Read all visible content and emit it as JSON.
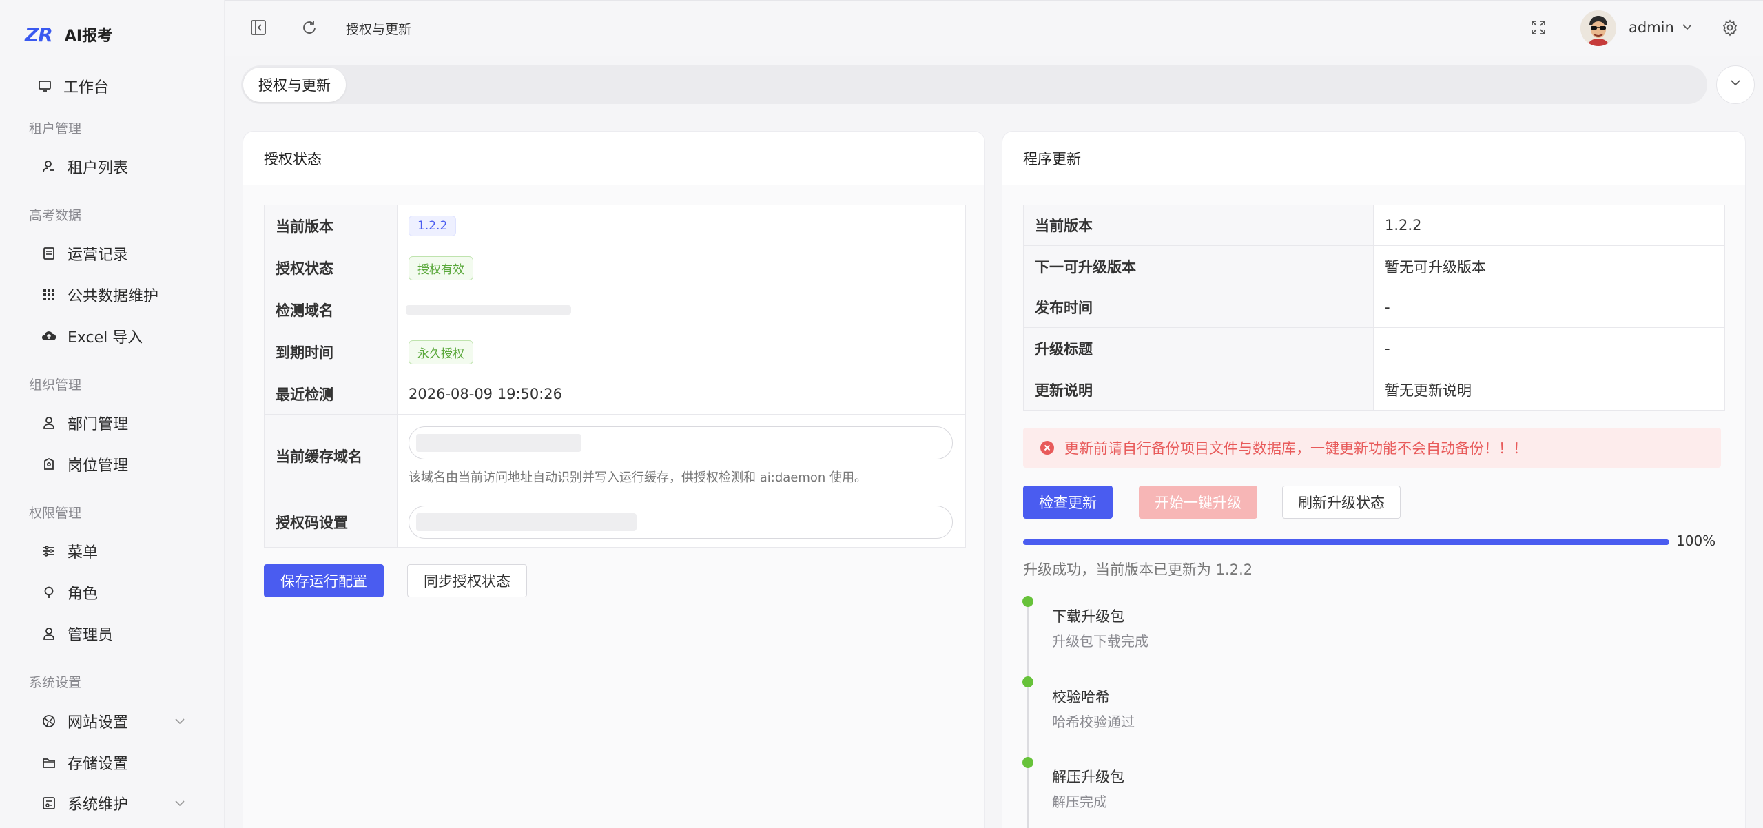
{
  "brand": {
    "logo_mark": "ZR",
    "app_name": "AI报考"
  },
  "sidebar": {
    "workbench": "工作台",
    "groups": [
      {
        "title": "租户管理",
        "items": [
          {
            "label": "租户列表",
            "icon": "user-list-icon"
          }
        ]
      },
      {
        "title": "高考数据",
        "items": [
          {
            "label": "运营记录",
            "icon": "document-icon"
          },
          {
            "label": "公共数据维护",
            "icon": "grid-icon"
          },
          {
            "label": "Excel 导入",
            "icon": "cloud-upload-icon"
          }
        ]
      },
      {
        "title": "组织管理",
        "items": [
          {
            "label": "部门管理",
            "icon": "user-icon"
          },
          {
            "label": "岗位管理",
            "icon": "badge-icon"
          }
        ]
      },
      {
        "title": "权限管理",
        "items": [
          {
            "label": "菜单",
            "icon": "sliders-icon"
          },
          {
            "label": "角色",
            "icon": "bulb-icon"
          },
          {
            "label": "管理员",
            "icon": "user-icon"
          }
        ]
      },
      {
        "title": "系统设置",
        "items": [
          {
            "label": "网站设置",
            "icon": "globe-icon",
            "has_children": true
          },
          {
            "label": "存储设置",
            "icon": "folder-icon"
          },
          {
            "label": "系统维护",
            "icon": "tools-icon",
            "has_children": true
          }
        ]
      }
    ]
  },
  "topbar": {
    "breadcrumb": "授权与更新",
    "user_name": "admin"
  },
  "tabs": {
    "active": "授权与更新"
  },
  "license_card": {
    "title": "授权状态",
    "rows": {
      "version_label": "当前版本",
      "version_value": "1.2.2",
      "status_label": "授权状态",
      "status_value": "授权有效",
      "domain_label": "检测域名",
      "expire_label": "到期时间",
      "expire_value": "永久授权",
      "last_check_label": "最近检测",
      "last_check_value": "2026-08-09 19:50:26",
      "cache_domain_label": "当前缓存域名",
      "cache_domain_hint": "该域名由当前访问地址自动识别并写入运行缓存，供授权检测和 ai:daemon 使用。",
      "license_code_label": "授权码设置"
    },
    "save_button": "保存运行配置",
    "sync_button": "同步授权状态"
  },
  "update_card": {
    "title": "程序更新",
    "rows": {
      "current_version_label": "当前版本",
      "current_version_value": "1.2.2",
      "next_version_label": "下一可升级版本",
      "next_version_value": "暂无可升级版本",
      "release_time_label": "发布时间",
      "release_time_value": "-",
      "upgrade_title_label": "升级标题",
      "upgrade_title_value": "-",
      "notes_label": "更新说明",
      "notes_value": "暂无更新说明"
    },
    "alert": "更新前请自行备份项目文件与数据库，一键更新功能不会自动备份！！！",
    "check_button": "检查更新",
    "upgrade_button": "开始一键升级",
    "refresh_button": "刷新升级状态",
    "progress_percent": 100,
    "progress_text": "100%",
    "status_text": "升级成功，当前版本已更新为 1.2.2",
    "timeline": [
      {
        "title": "下载升级包",
        "desc": "升级包下载完成"
      },
      {
        "title": "校验哈希",
        "desc": "哈希校验通过"
      },
      {
        "title": "解压升级包",
        "desc": "解压完成"
      }
    ]
  },
  "colors": {
    "primary": "#4a5cf0",
    "success": "#67c23a",
    "danger": "#e85a5a"
  }
}
